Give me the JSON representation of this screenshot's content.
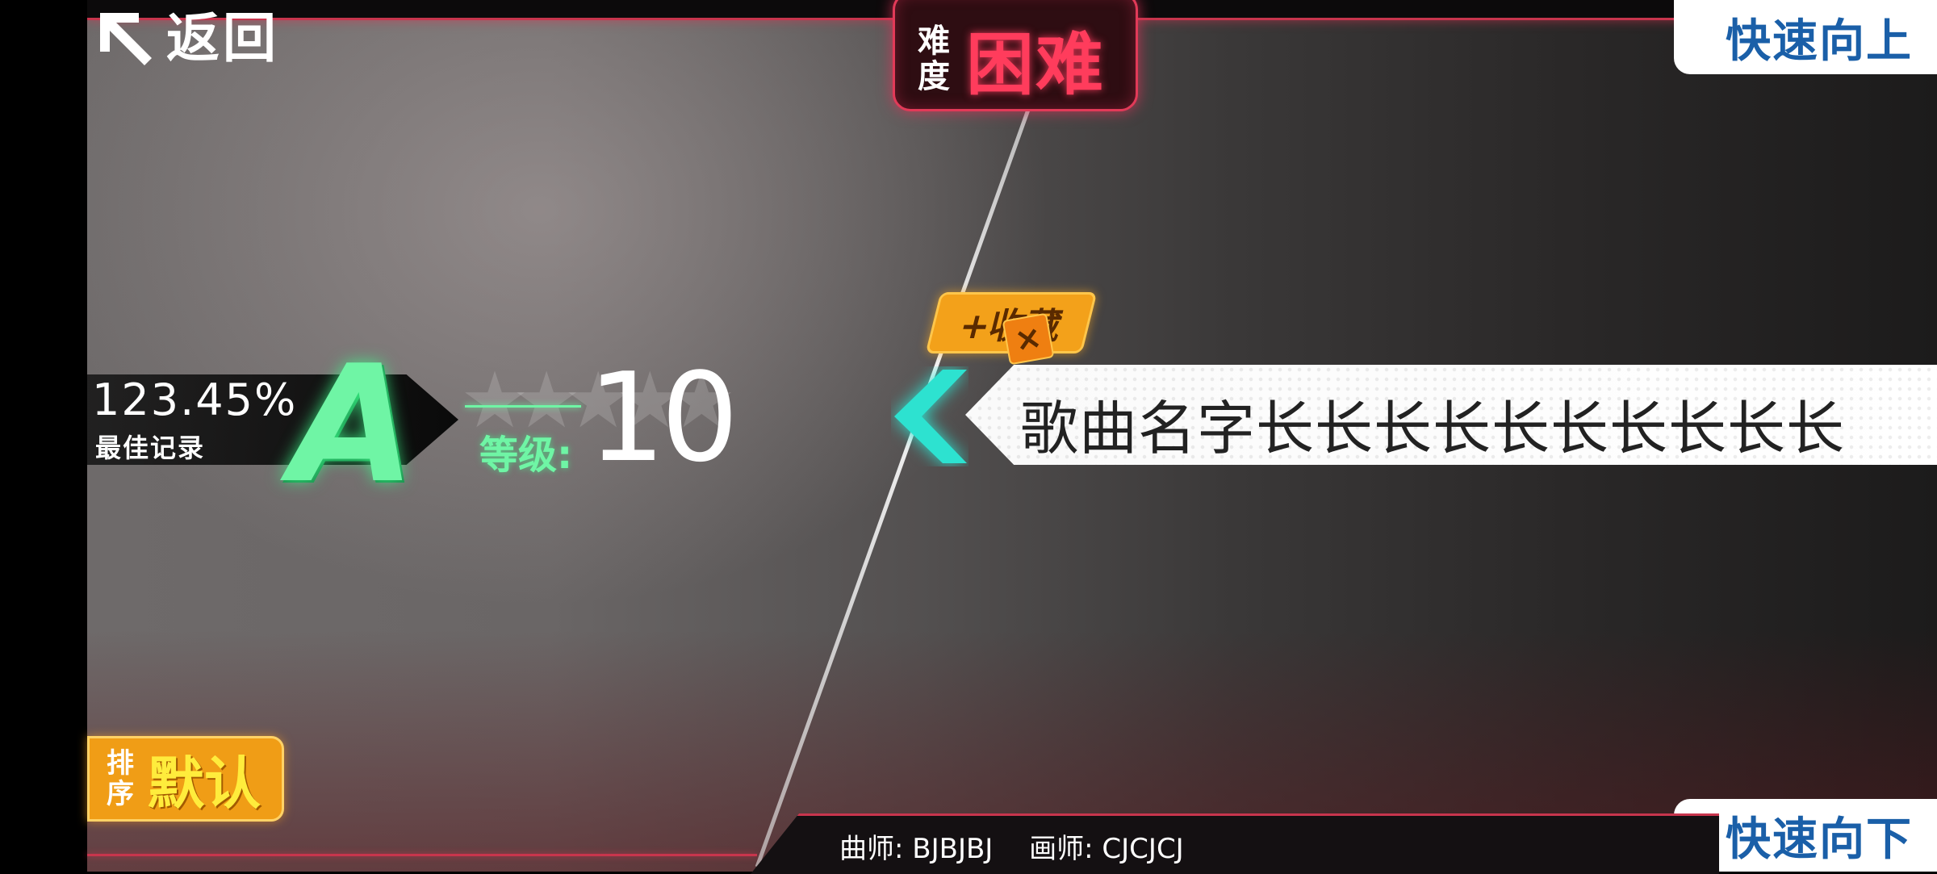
{
  "nav": {
    "back_label": "返回"
  },
  "difficulty": {
    "label": "难度",
    "value": "困难"
  },
  "quick": {
    "up_label": "快速向上",
    "down_label": "快速向下"
  },
  "record": {
    "best_score": "123.45%",
    "best_label": "最佳记录",
    "grade": "A"
  },
  "level": {
    "label": "等级:",
    "value": "10"
  },
  "favorite": {
    "label": "+收藏",
    "close": "×"
  },
  "song": {
    "title": "歌曲名字长长长长长长长长长长"
  },
  "sort": {
    "label": "排序",
    "value": "默认"
  },
  "credits": {
    "composer": "曲师: BJBJBJ",
    "artist": "画师: CJCJCJ"
  },
  "colors": {
    "accent_red": "#e23a58",
    "grade_green": "#6ff5a5",
    "chevron_cyan": "#2de2d0",
    "quick_blue": "#1a5fa8",
    "sort_orange": "#f09d16"
  }
}
